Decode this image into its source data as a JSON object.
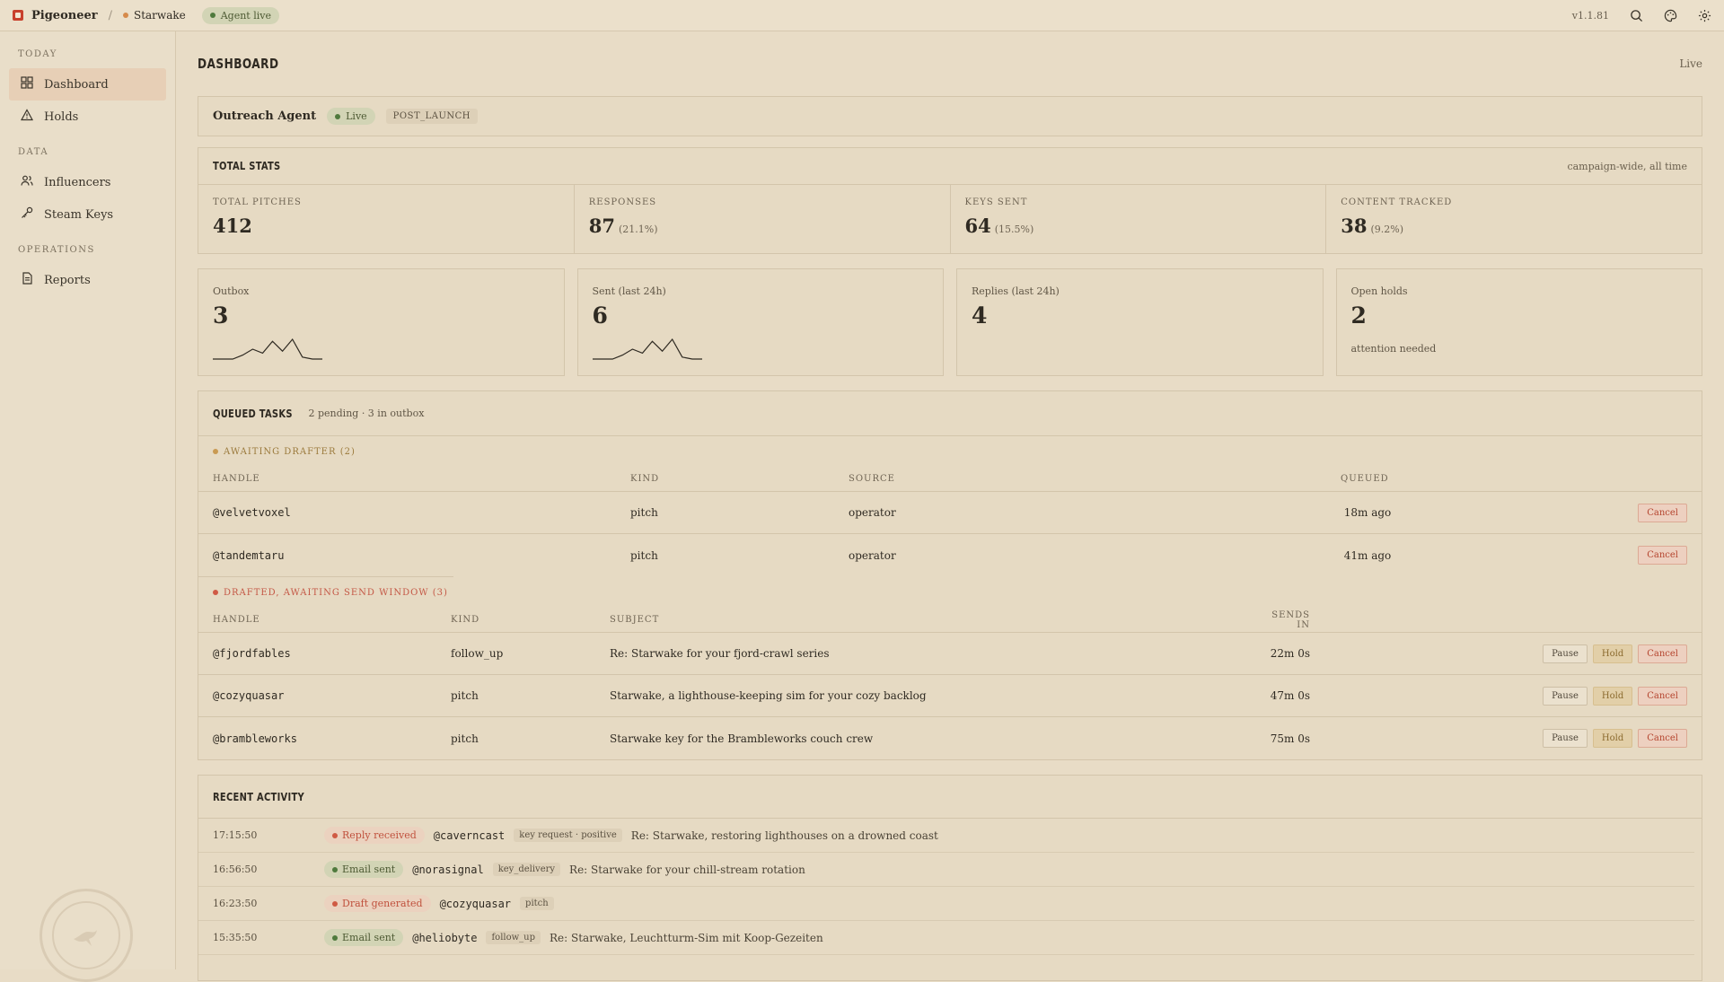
{
  "topbar": {
    "brand": "Pigeoneer",
    "separator": "/",
    "project": "Starwake",
    "agent_status": "Agent live",
    "version": "v1.1.81",
    "icons": [
      "search-icon",
      "palette-icon",
      "gear-icon"
    ]
  },
  "sidebar": {
    "sections": [
      {
        "title": "TODAY",
        "items": [
          {
            "label": "Dashboard",
            "icon": "grid-icon",
            "active": true
          },
          {
            "label": "Holds",
            "icon": "warning-icon",
            "active": false
          }
        ]
      },
      {
        "title": "DATA",
        "items": [
          {
            "label": "Influencers",
            "icon": "users-icon",
            "active": false
          },
          {
            "label": "Steam Keys",
            "icon": "key-icon",
            "active": false
          }
        ]
      },
      {
        "title": "OPERATIONS",
        "items": [
          {
            "label": "Reports",
            "icon": "document-icon",
            "active": false
          }
        ]
      }
    ],
    "stamp_text": "PIGEONEER AIR MAIL"
  },
  "page": {
    "title": "DASHBOARD",
    "live": "Live"
  },
  "agent": {
    "name": "Outreach Agent",
    "status": "Live",
    "phase": "POST_LAUNCH"
  },
  "total_stats": {
    "title": "TOTAL STATS",
    "note": "campaign-wide, all time",
    "items": [
      {
        "label": "TOTAL PITCHES",
        "value": "412",
        "pct": ""
      },
      {
        "label": "RESPONSES",
        "value": "87",
        "pct": "(21.1%)"
      },
      {
        "label": "KEYS SENT",
        "value": "64",
        "pct": "(15.5%)"
      },
      {
        "label": "CONTENT TRACKED",
        "value": "38",
        "pct": "(9.2%)"
      }
    ]
  },
  "tiles": [
    {
      "label": "Outbox",
      "value": "3",
      "sub": "",
      "spark": [
        0,
        0,
        0,
        2,
        5,
        3,
        9,
        4,
        10,
        1,
        0,
        0
      ]
    },
    {
      "label": "Sent (last 24h)",
      "value": "6",
      "sub": "",
      "spark": [
        0,
        0,
        0,
        2,
        5,
        3,
        9,
        4,
        10,
        1,
        0,
        0
      ]
    },
    {
      "label": "Replies (last 24h)",
      "value": "4",
      "sub": ""
    },
    {
      "label": "Open holds",
      "value": "2",
      "sub": "attention needed"
    }
  ],
  "queue": {
    "title": "QUEUED TASKS",
    "summary": "2 pending · 3 in outbox",
    "awaiting_drafter": {
      "label": "AWAITING DRAFTER (2)",
      "columns": [
        "HANDLE",
        "KIND",
        "SOURCE",
        "QUEUED"
      ],
      "rows": [
        {
          "handle": "@velvetvoxel",
          "kind": "pitch",
          "source": "operator",
          "queued": "18m ago"
        },
        {
          "handle": "@tandemtaru",
          "kind": "pitch",
          "source": "operator",
          "queued": "41m ago"
        }
      ]
    },
    "drafted": {
      "label": "DRAFTED, AWAITING SEND WINDOW (3)",
      "columns": [
        "HANDLE",
        "KIND",
        "SUBJECT",
        "SENDS IN"
      ],
      "rows": [
        {
          "handle": "@fjordfables",
          "kind": "follow_up",
          "subject": "Re: Starwake for your fjord-crawl series",
          "sends_in": "22m 0s"
        },
        {
          "handle": "@cozyquasar",
          "kind": "pitch",
          "subject": "Starwake, a lighthouse-keeping sim for your cozy backlog",
          "sends_in": "47m 0s"
        },
        {
          "handle": "@brambleworks",
          "kind": "pitch",
          "subject": "Starwake key for the Brambleworks couch crew",
          "sends_in": "75m 0s"
        }
      ]
    },
    "buttons": {
      "pause": "Pause",
      "hold": "Hold",
      "cancel": "Cancel"
    }
  },
  "activity": {
    "title": "RECENT ACTIVITY",
    "rows": [
      {
        "time": "17:15:50",
        "event": "Reply received",
        "type": "reply",
        "handle": "@caverncast",
        "tag": "key request · positive",
        "subject": "Re: Starwake, restoring lighthouses on a drowned coast"
      },
      {
        "time": "16:56:50",
        "event": "Email sent",
        "type": "sent",
        "handle": "@norasignal",
        "tag": "key_delivery",
        "subject": "Re: Starwake for your chill-stream rotation"
      },
      {
        "time": "16:23:50",
        "event": "Draft generated",
        "type": "draft",
        "handle": "@cozyquasar",
        "tag": "pitch",
        "subject": ""
      },
      {
        "time": "15:35:50",
        "event": "Email sent",
        "type": "sent",
        "handle": "@heliobyte",
        "tag": "follow_up",
        "subject": "Re: Starwake, Leuchtturm-Sim mit Koop-Gezeiten"
      }
    ]
  }
}
